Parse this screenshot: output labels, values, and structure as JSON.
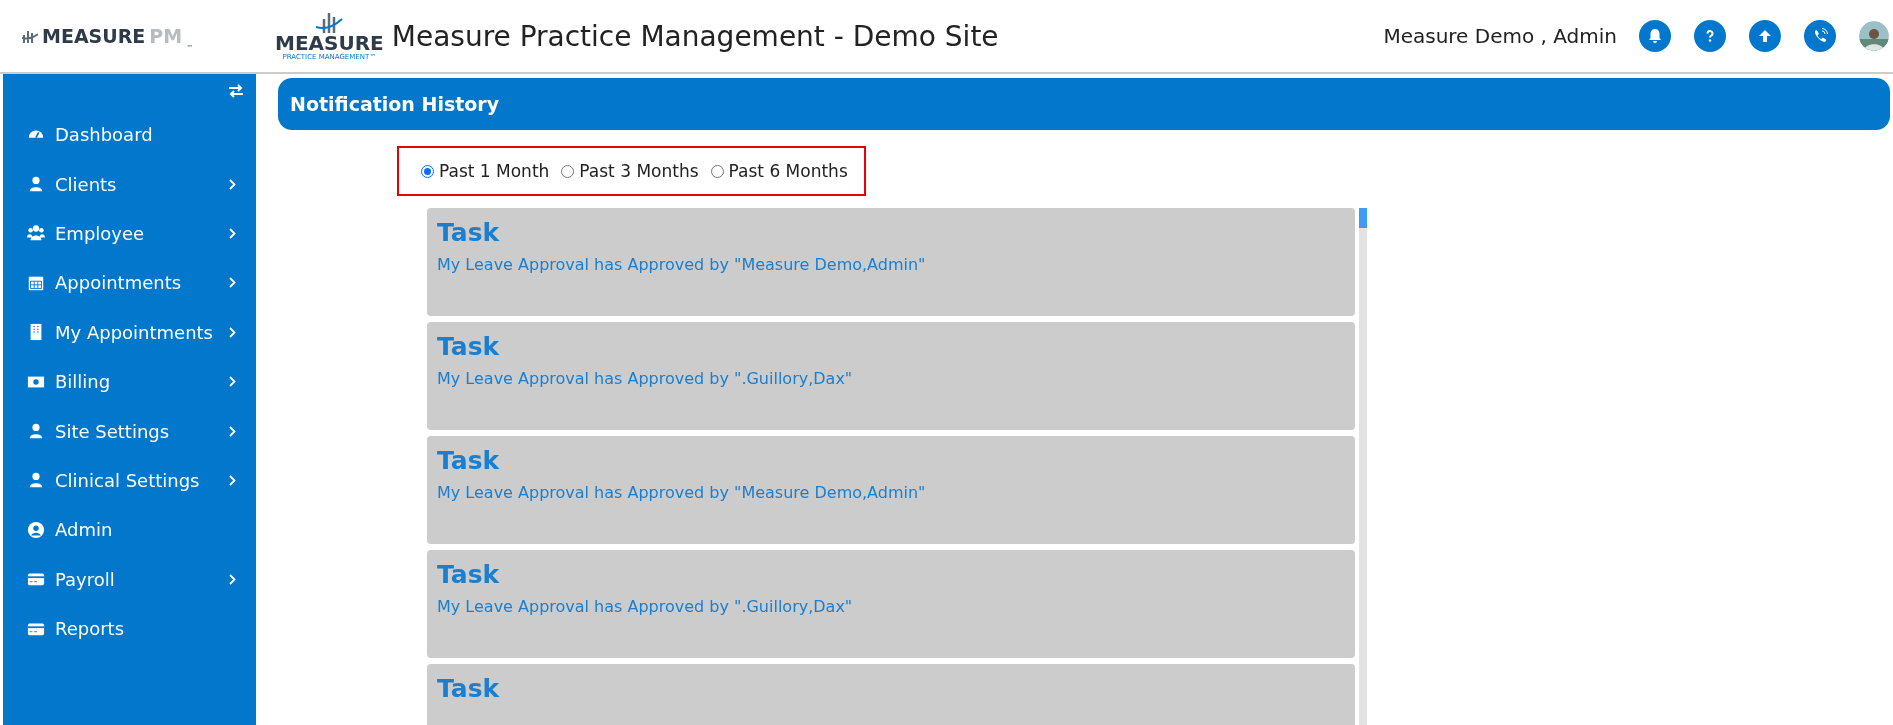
{
  "header": {
    "brand_logo": {
      "name": "MEASURE",
      "suffix": "PM",
      "mark": "™"
    },
    "site_logo": {
      "name": "MEASURE",
      "tagline": "PRACTICE MANAGEMENT™"
    },
    "title": "Measure Practice Management - Demo Site",
    "user": "Measure Demo , Admin"
  },
  "sidebar": {
    "items": [
      {
        "label": "Dashboard",
        "has_submenu": false
      },
      {
        "label": "Clients",
        "has_submenu": true
      },
      {
        "label": "Employee",
        "has_submenu": true
      },
      {
        "label": "Appointments",
        "has_submenu": true
      },
      {
        "label": "My Appointments",
        "has_submenu": true
      },
      {
        "label": "Billing",
        "has_submenu": true
      },
      {
        "label": "Site Settings",
        "has_submenu": true
      },
      {
        "label": "Clinical Settings",
        "has_submenu": true
      },
      {
        "label": "Admin",
        "has_submenu": false
      },
      {
        "label": "Payroll",
        "has_submenu": true
      },
      {
        "label": "Reports",
        "has_submenu": false
      }
    ]
  },
  "page": {
    "title": "Notification History",
    "periods": [
      {
        "label": "Past 1 Month",
        "selected": true
      },
      {
        "label": "Past 3 Months",
        "selected": false
      },
      {
        "label": "Past 6 Months",
        "selected": false
      }
    ],
    "notifications": [
      {
        "title": "Task",
        "message": "My Leave Approval has Approved by \"Measure Demo,Admin\""
      },
      {
        "title": "Task",
        "message": "My Leave Approval has Approved by \".Guillory,Dax\""
      },
      {
        "title": "Task",
        "message": "My Leave Approval has Approved by \"Measure Demo,Admin\""
      },
      {
        "title": "Task",
        "message": "My Leave Approval has Approved by \".Guillory,Dax\""
      },
      {
        "title": "Task"
      }
    ]
  }
}
